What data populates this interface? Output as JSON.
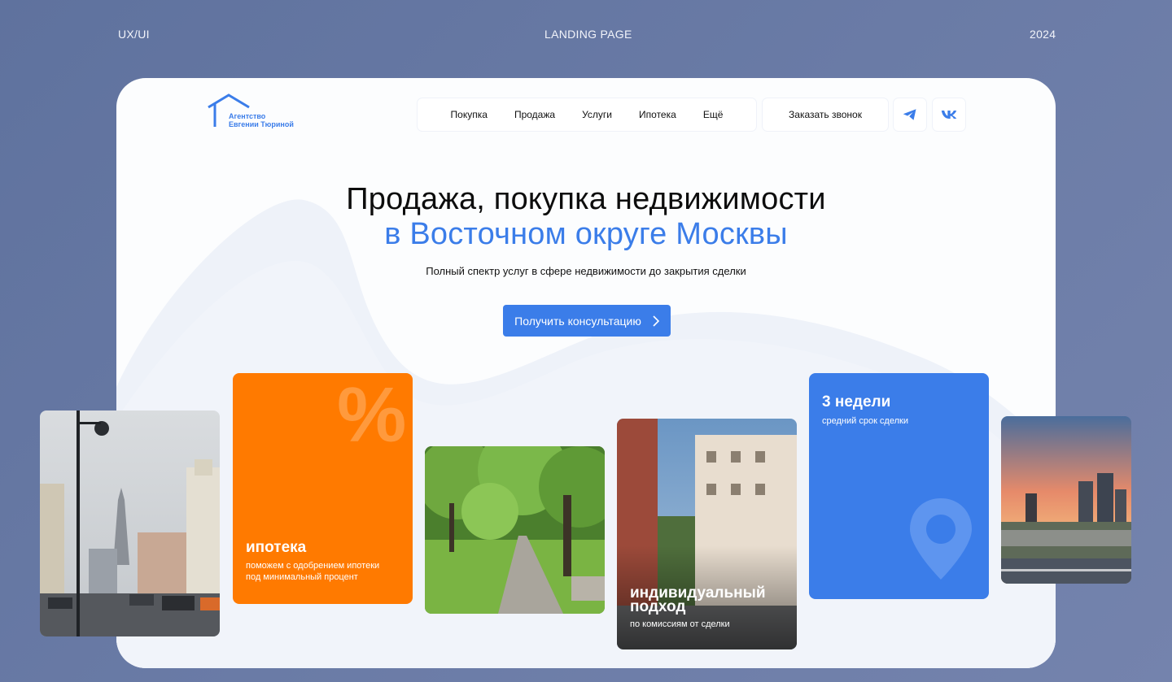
{
  "header": {
    "left": "UX/UI",
    "center": "LANDING PAGE",
    "right": "2024"
  },
  "logo": {
    "line1": "Агентство",
    "line2": "Евгении Тюриной"
  },
  "nav": {
    "items": [
      {
        "label": "Покупка"
      },
      {
        "label": "Продажа"
      },
      {
        "label": "Услуги"
      },
      {
        "label": "Ипотека"
      },
      {
        "label": "Ещё"
      }
    ],
    "call_button": "Заказать звонок",
    "social": [
      {
        "icon": "telegram-icon"
      },
      {
        "icon": "vk-icon"
      }
    ]
  },
  "hero": {
    "title_line1": "Продажа, покупка недвижимости",
    "title_line2": "в Восточном округе Москвы",
    "subtitle": "Полный спектр услуг в сфере недвижимости до закрытия сделки",
    "cta_label": "Получить консультацию"
  },
  "tiles": {
    "mortgage": {
      "symbol": "%",
      "title": "ипотека",
      "subtitle_line1": "поможем с одобрением ипотеки",
      "subtitle_line2": "под минимальный процент"
    },
    "approach": {
      "title_line1": "индивидуальный",
      "title_line2": "подход",
      "subtitle": "по комиссиям от сделки"
    },
    "weeks": {
      "title": "3 недели",
      "subtitle": "средний срок сделки"
    }
  },
  "colors": {
    "accent": "#3b7de9",
    "orange": "#ff7a00",
    "background": "#6677a3"
  }
}
